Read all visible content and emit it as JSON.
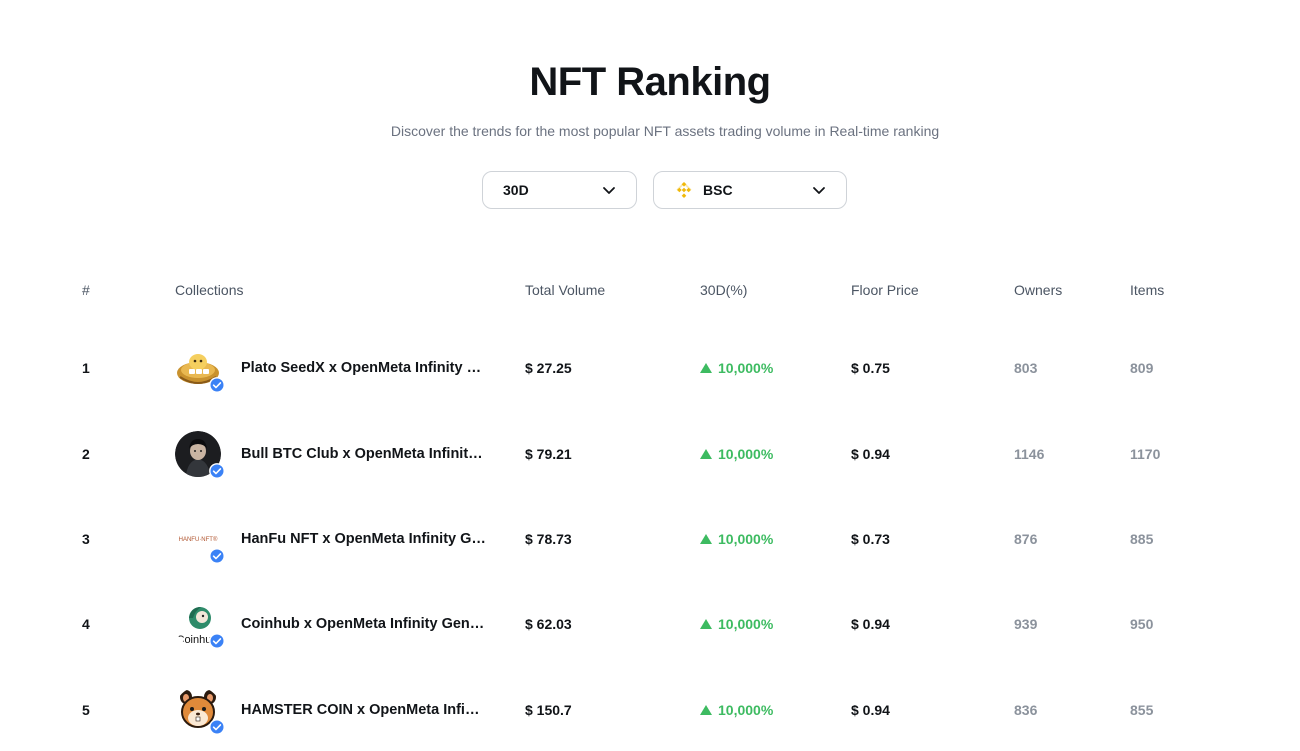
{
  "header": {
    "title": "NFT Ranking",
    "subtitle": "Discover the trends for the most popular NFT assets trading volume in Real-time ranking"
  },
  "filters": {
    "period": {
      "selected": "30D",
      "icon": "chevron-down-icon"
    },
    "chain": {
      "selected": "BSC",
      "icon": "bnb-chain-icon"
    }
  },
  "table": {
    "columns": [
      "#",
      "Collections",
      "Total Volume",
      "30D(%)",
      "Floor Price",
      "Owners",
      "Items"
    ],
    "rows": [
      {
        "rank": "1",
        "name": "Plato SeedX x OpenMeta Infinity Genesis",
        "volume": "$ 27.25",
        "change": "10,000%",
        "floor": "$ 0.75",
        "owners": "803",
        "items": "809"
      },
      {
        "rank": "2",
        "name": "Bull BTC Club x OpenMeta Infinity Genesis",
        "volume": "$ 79.21",
        "change": "10,000%",
        "floor": "$ 0.94",
        "owners": "1146",
        "items": "1170"
      },
      {
        "rank": "3",
        "name": "HanFu NFT x OpenMeta Infinity Genesis",
        "volume": "$ 78.73",
        "change": "10,000%",
        "floor": "$ 0.73",
        "owners": "876",
        "items": "885"
      },
      {
        "rank": "4",
        "name": "Coinhub x OpenMeta Infinity Genesis",
        "volume": "$ 62.03",
        "change": "10,000%",
        "floor": "$ 0.94",
        "owners": "939",
        "items": "950"
      },
      {
        "rank": "5",
        "name": "HAMSTER COIN x OpenMeta Infinity Genesis",
        "volume": "$ 150.7",
        "change": "10,000%",
        "floor": "$ 0.94",
        "owners": "836",
        "items": "855"
      }
    ],
    "avatar_labels": {
      "hanfu": "HANFU·NFT®",
      "coinhub": "Coinhub"
    }
  },
  "colors": {
    "positive": "#3dbb61",
    "verified": "#3b82f6",
    "bnb": "#f0b90b",
    "muted": "#8b929c"
  }
}
